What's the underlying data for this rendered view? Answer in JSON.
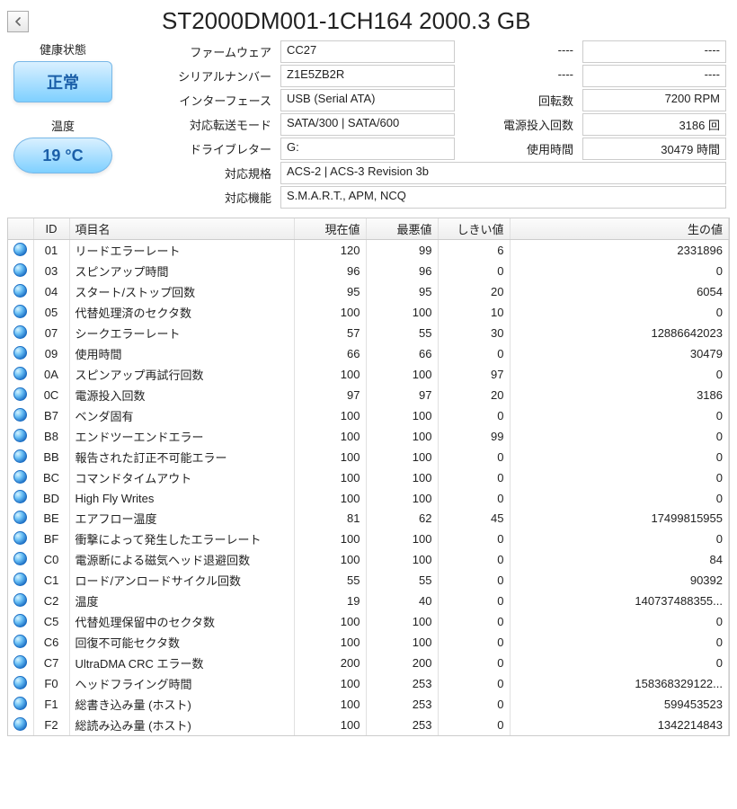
{
  "title": "ST2000DM001-1CH164 2000.3 GB",
  "health": {
    "label": "健康状態",
    "value": "正常"
  },
  "temperature": {
    "label": "温度",
    "value": "19 °C"
  },
  "info": {
    "firmware_label": "ファームウェア",
    "firmware": "CC27",
    "serial_label": "シリアルナンバー",
    "serial": "Z1E5ZB2R",
    "interface_label": "インターフェース",
    "interface": "USB (Serial ATA)",
    "transfer_label": "対応転送モード",
    "transfer": "SATA/300 | SATA/600",
    "letter_label": "ドライブレター",
    "letter": "G:",
    "standard_label": "対応規格",
    "standard": "ACS-2 | ACS-3 Revision 3b",
    "features_label": "対応機能",
    "features": "S.M.A.R.T., APM, NCQ",
    "rpm_label": "回転数",
    "rpm": "7200 RPM",
    "poweron_label": "電源投入回数",
    "poweron": "3186 回",
    "hours_label": "使用時間",
    "hours": "30479 時間",
    "blank1_l": "----",
    "blank1_v": "----",
    "blank2_l": "----",
    "blank2_v": "----"
  },
  "columns": {
    "icon": "",
    "id": "ID",
    "name": "項目名",
    "current": "現在値",
    "worst": "最悪値",
    "threshold": "しきい値",
    "raw": "生の値"
  },
  "rows": [
    {
      "id": "01",
      "name": "リードエラーレート",
      "cur": "120",
      "wor": "99",
      "thr": "6",
      "raw": "2331896"
    },
    {
      "id": "03",
      "name": "スピンアップ時間",
      "cur": "96",
      "wor": "96",
      "thr": "0",
      "raw": "0"
    },
    {
      "id": "04",
      "name": "スタート/ストップ回数",
      "cur": "95",
      "wor": "95",
      "thr": "20",
      "raw": "6054"
    },
    {
      "id": "05",
      "name": "代替処理済のセクタ数",
      "cur": "100",
      "wor": "100",
      "thr": "10",
      "raw": "0"
    },
    {
      "id": "07",
      "name": "シークエラーレート",
      "cur": "57",
      "wor": "55",
      "thr": "30",
      "raw": "12886642023"
    },
    {
      "id": "09",
      "name": "使用時間",
      "cur": "66",
      "wor": "66",
      "thr": "0",
      "raw": "30479"
    },
    {
      "id": "0A",
      "name": "スピンアップ再試行回数",
      "cur": "100",
      "wor": "100",
      "thr": "97",
      "raw": "0"
    },
    {
      "id": "0C",
      "name": "電源投入回数",
      "cur": "97",
      "wor": "97",
      "thr": "20",
      "raw": "3186"
    },
    {
      "id": "B7",
      "name": "ベンダ固有",
      "cur": "100",
      "wor": "100",
      "thr": "0",
      "raw": "0"
    },
    {
      "id": "B8",
      "name": "エンドツーエンドエラー",
      "cur": "100",
      "wor": "100",
      "thr": "99",
      "raw": "0"
    },
    {
      "id": "BB",
      "name": "報告された訂正不可能エラー",
      "cur": "100",
      "wor": "100",
      "thr": "0",
      "raw": "0"
    },
    {
      "id": "BC",
      "name": "コマンドタイムアウト",
      "cur": "100",
      "wor": "100",
      "thr": "0",
      "raw": "0"
    },
    {
      "id": "BD",
      "name": "High Fly Writes",
      "cur": "100",
      "wor": "100",
      "thr": "0",
      "raw": "0"
    },
    {
      "id": "BE",
      "name": "エアフロー温度",
      "cur": "81",
      "wor": "62",
      "thr": "45",
      "raw": "17499815955"
    },
    {
      "id": "BF",
      "name": "衝撃によって発生したエラーレート",
      "cur": "100",
      "wor": "100",
      "thr": "0",
      "raw": "0"
    },
    {
      "id": "C0",
      "name": "電源断による磁気ヘッド退避回数",
      "cur": "100",
      "wor": "100",
      "thr": "0",
      "raw": "84"
    },
    {
      "id": "C1",
      "name": "ロード/アンロードサイクル回数",
      "cur": "55",
      "wor": "55",
      "thr": "0",
      "raw": "90392"
    },
    {
      "id": "C2",
      "name": "温度",
      "cur": "19",
      "wor": "40",
      "thr": "0",
      "raw": "140737488355..."
    },
    {
      "id": "C5",
      "name": "代替処理保留中のセクタ数",
      "cur": "100",
      "wor": "100",
      "thr": "0",
      "raw": "0"
    },
    {
      "id": "C6",
      "name": "回復不可能セクタ数",
      "cur": "100",
      "wor": "100",
      "thr": "0",
      "raw": "0"
    },
    {
      "id": "C7",
      "name": "UltraDMA CRC エラー数",
      "cur": "200",
      "wor": "200",
      "thr": "0",
      "raw": "0"
    },
    {
      "id": "F0",
      "name": "ヘッドフライング時間",
      "cur": "100",
      "wor": "253",
      "thr": "0",
      "raw": "158368329122..."
    },
    {
      "id": "F1",
      "name": "総書き込み量 (ホスト)",
      "cur": "100",
      "wor": "253",
      "thr": "0",
      "raw": "599453523"
    },
    {
      "id": "F2",
      "name": "総読み込み量 (ホスト)",
      "cur": "100",
      "wor": "253",
      "thr": "0",
      "raw": "1342214843"
    }
  ]
}
